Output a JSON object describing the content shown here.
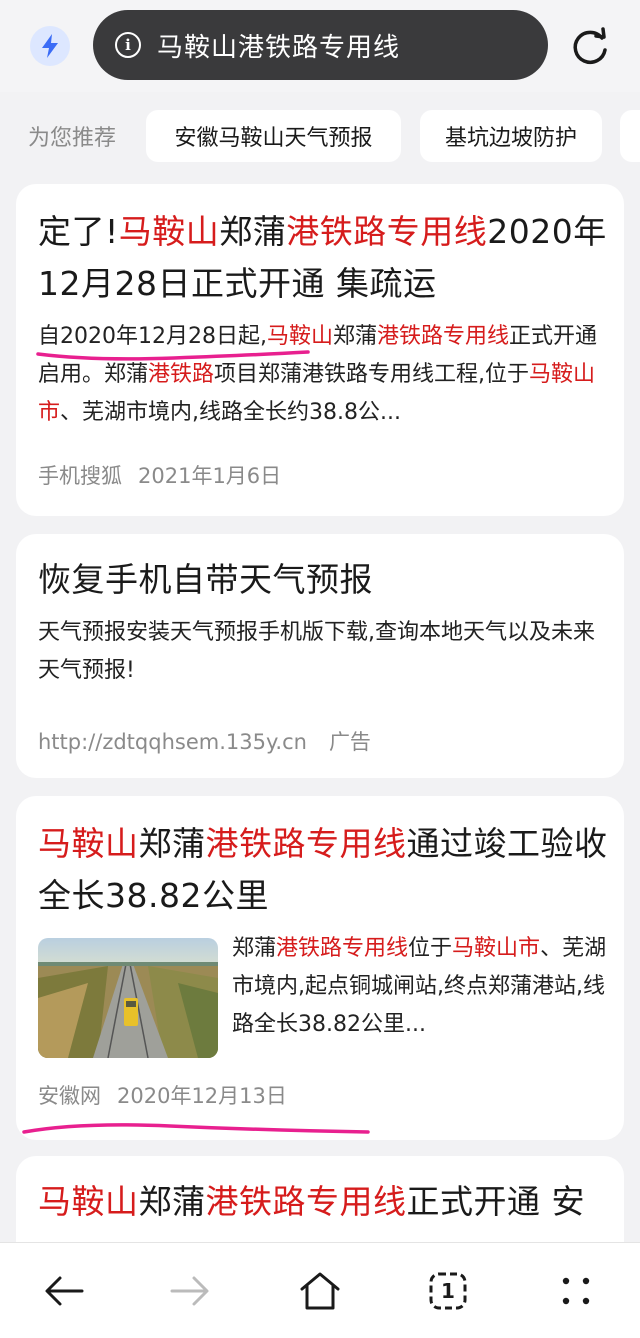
{
  "toolbar": {
    "search_query": "马鞍山港铁路专用线",
    "info_glyph": "i",
    "icons": [
      "bolt-icon",
      "info-icon",
      "refresh-icon"
    ]
  },
  "recommend": {
    "label": "为您推荐",
    "chips": [
      "安徽马鞍山天气预报",
      "基坑边坡防护"
    ]
  },
  "results": [
    {
      "title_parts": [
        "定了!",
        "马鞍山",
        "郑蒲",
        "港铁路专用线",
        "2020年12月28日正式开通 集疏运"
      ],
      "snippet_parts": [
        "自2020年12月28日起,",
        "马鞍山",
        "郑蒲",
        "港铁路专用线",
        "正式开通启用。郑蒲",
        "港铁路",
        "项目郑蒲港铁路专用线工程,位于",
        "马鞍山市",
        "、芜湖市境内,线路全长约38.8公..."
      ],
      "source": "手机搜狐",
      "date": "2021年1月6日"
    },
    {
      "title": "恢复手机自带天气预报",
      "snippet": "天气预报安装天气预报手机版下载,查询本地天气以及未来天气预报!",
      "url": "http://zdtqqhsem.135y.cn",
      "ad_label": "广告"
    },
    {
      "title_parts": [
        "马鞍山",
        "郑蒲",
        "港铁路专用线",
        "通过竣工验收全长38.82公里"
      ],
      "snippet_parts": [
        "郑蒲",
        "港铁路专用线",
        "位于",
        "马鞍山市",
        "、芜湖市境内,起点铜城闸站,终点郑蒲港站,线路全长38.82公里..."
      ],
      "source": "安徽网",
      "date": "2020年12月13日"
    },
    {
      "title_parts": [
        "马鞍山",
        "郑蒲",
        "港铁路专用线",
        "正式开通 安"
      ]
    }
  ],
  "bottom_nav": {
    "tab_count": "1",
    "icons": [
      "back-arrow-icon",
      "forward-arrow-icon",
      "home-icon",
      "tabs-icon",
      "menu-dots-icon"
    ]
  },
  "colors": {
    "highlight": "#d61c1c",
    "annotation": "#e8208f",
    "url_pill": "#3a3a3c",
    "accent_blue": "#3b6cf6"
  }
}
